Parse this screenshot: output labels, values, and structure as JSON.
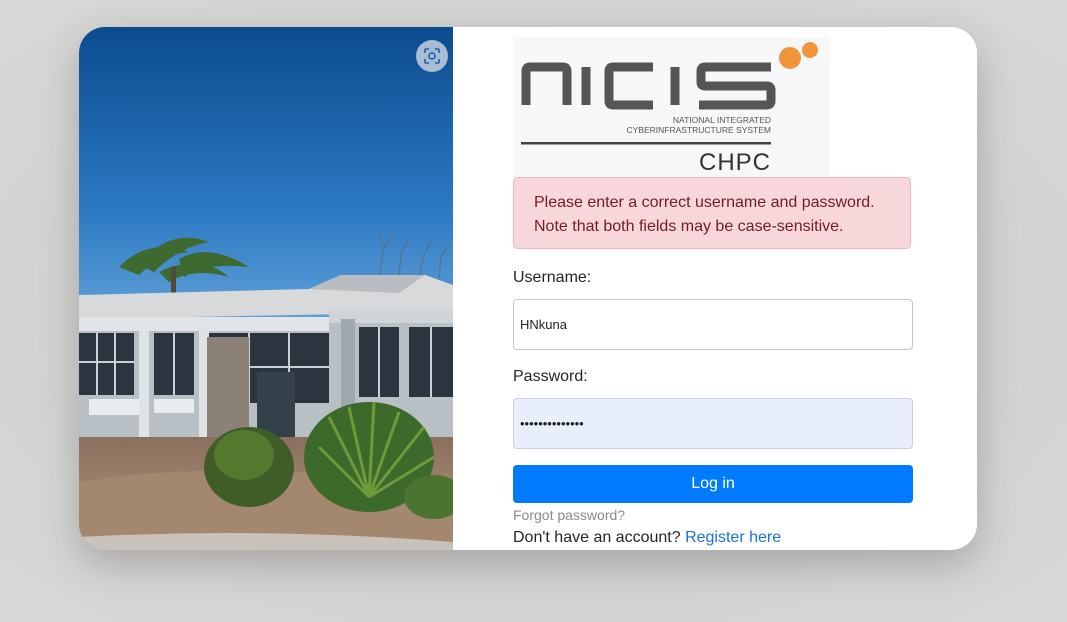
{
  "logo": {
    "wordmark": "nicis",
    "tagline_line1": "NATIONAL INTEGRATED",
    "tagline_line2": "CYBERINFRASTRUCTURE SYSTEM",
    "sub_brand": "CHPC",
    "accent_color": "#f0953a"
  },
  "alert": {
    "line1": "Please enter a correct username and password.",
    "line2": "Note that both fields may be case-sensitive."
  },
  "form": {
    "username_label": "Username:",
    "username_value": "HNkuna",
    "password_label": "Password:",
    "password_value": "••••••••••••••",
    "login_label": "Log in",
    "forgot_label": "Forgot password?",
    "no_account_text": "Don't have an account?",
    "register_label": "Register here"
  },
  "colors": {
    "primary": "#007bff",
    "alert_bg": "#f8d7da",
    "alert_text": "#721c24",
    "link": "#1a73d9"
  },
  "icons": {
    "lens": "visual-search-icon"
  }
}
